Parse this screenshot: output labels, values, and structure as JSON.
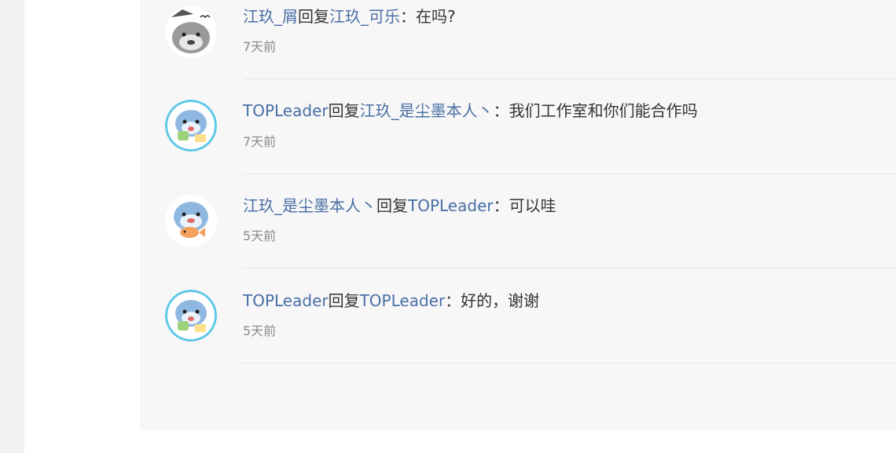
{
  "replies": [
    {
      "author": "江玖_屑",
      "reply_word": "回复",
      "target": "江玖_可乐",
      "colon": "：",
      "content": "在吗?",
      "time": "7天前",
      "avatar": "shark-avatar-gray"
    },
    {
      "author": "TOPLeader",
      "reply_word": "回复",
      "target": "江玖_是尘墨本人丶",
      "colon": "：",
      "content": "我们工作室和你们能合作吗",
      "time": "7天前",
      "avatar": "shark-avatar-blue-cyan-ring"
    },
    {
      "author": "江玖_是尘墨本人丶",
      "reply_word": "回复",
      "target": "TOPLeader",
      "colon": "：",
      "content": "可以哇",
      "time": "5天前",
      "avatar": "shark-avatar-with-fish"
    },
    {
      "author": "TOPLeader",
      "reply_word": "回复",
      "target": "TOPLeader",
      "colon": "：",
      "content": "好的，谢谢",
      "time": "5天前",
      "avatar": "shark-avatar-blue-cyan-ring"
    }
  ],
  "colors": {
    "link": "#4a6fa5",
    "text": "#333333",
    "muted": "#8a8a8a",
    "panel": "#f7f7f7",
    "divider": "#e6e6e6"
  }
}
